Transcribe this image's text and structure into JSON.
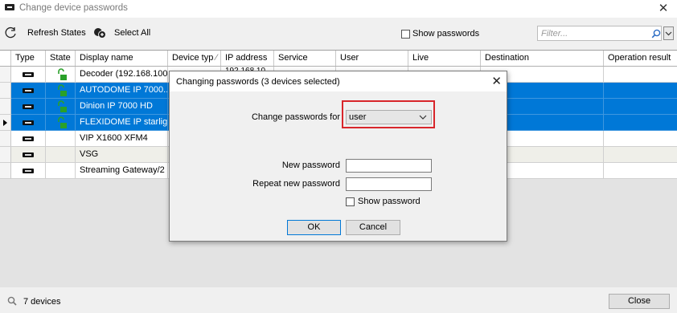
{
  "window": {
    "title": "Change device passwords",
    "close_glyph": "✕"
  },
  "toolbar": {
    "refresh_label": "Refresh States",
    "select_all_label": "Select All",
    "show_passwords_label": "Show passwords",
    "filter_placeholder": "Filter..."
  },
  "grid": {
    "columns": [
      "Type",
      "State",
      "Display name",
      "Device typ",
      "IP address",
      "Service",
      "User",
      "Live",
      "Destination",
      "Operation result"
    ],
    "sort_indicator": "⁄",
    "rows": [
      {
        "display_name": "Decoder  (192.168.100...",
        "ip": "192.168.10...",
        "state": "unlocked",
        "selected": false,
        "current": false
      },
      {
        "display_name": "AUTODOME IP 7000...",
        "ip": "",
        "state": "unlocked",
        "selected": true,
        "current": false
      },
      {
        "display_name": "Dinion IP 7000 HD",
        "ip": "",
        "state": "unlocked",
        "selected": true,
        "current": false
      },
      {
        "display_name": "FLEXIDOME IP starlig...",
        "ip": "",
        "state": "unlocked",
        "selected": true,
        "current": true
      },
      {
        "display_name": "VIP X1600 XFM4",
        "ip": "",
        "state": "none",
        "selected": false,
        "current": false
      },
      {
        "display_name": "VSG",
        "ip": "",
        "state": "none",
        "selected": false,
        "current": false
      },
      {
        "display_name": "Streaming Gateway/2",
        "ip": "",
        "state": "none",
        "selected": false,
        "current": false
      }
    ]
  },
  "status": {
    "count": "7 devices",
    "close_label": "Close"
  },
  "dialog": {
    "title": "Changing passwords (3 devices selected)",
    "close_glyph": "✕",
    "change_for_label": "Change passwords for",
    "change_for_value": "user",
    "new_password_label": "New password",
    "repeat_password_label": "Repeat new password",
    "show_password_label": "Show password",
    "ok_label": "OK",
    "cancel_label": "Cancel"
  },
  "colors": {
    "selection": "#0078d7",
    "highlight": "#d8262b",
    "unlocked_icon": "#2aa02a"
  }
}
